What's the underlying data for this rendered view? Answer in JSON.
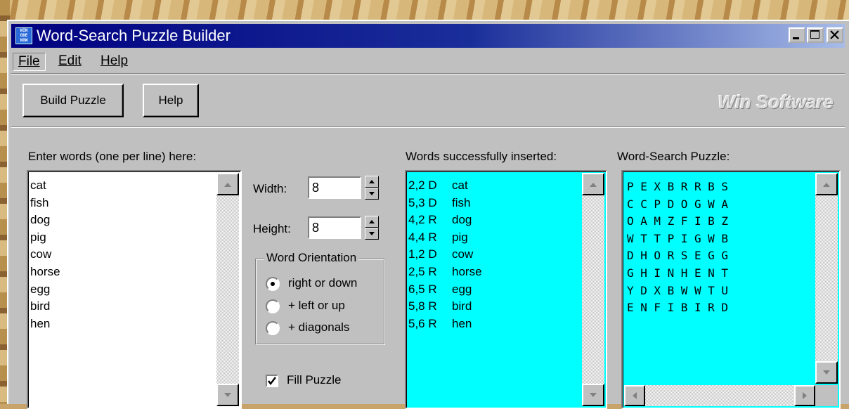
{
  "window": {
    "title": "Word-Search Puzzle Builder",
    "icon_text": "WIN ODE NOW",
    "title_buttons": [
      "minimize-icon",
      "maximize-icon",
      "close-icon"
    ]
  },
  "menu": {
    "items": [
      {
        "label": "File",
        "accel": "F"
      },
      {
        "label": "Edit",
        "accel": "E"
      },
      {
        "label": "Help",
        "accel": "H"
      }
    ]
  },
  "toolbar": {
    "build_label": "Build Puzzle",
    "help_label": "Help",
    "brand": "Win Software"
  },
  "words_panel": {
    "label": "Enter words (one per line) here:",
    "words": [
      "cat",
      "fish",
      "dog",
      "pig",
      "cow",
      "horse",
      "egg",
      "bird",
      "hen"
    ]
  },
  "settings": {
    "width_label": "Width:",
    "width_value": "8",
    "height_label": "Height:",
    "height_value": "8",
    "orientation_title": "Word Orientation",
    "orientation_options": [
      {
        "label": "right or down",
        "selected": true
      },
      {
        "label": "+ left or up",
        "selected": false
      },
      {
        "label": "+ diagonals",
        "selected": false
      }
    ],
    "fill_label": "Fill Puzzle",
    "fill_checked": true
  },
  "inserted_panel": {
    "label": "Words successfully inserted:",
    "entries": [
      {
        "pos": "2,2 D",
        "word": "cat"
      },
      {
        "pos": "5,3 D",
        "word": "fish"
      },
      {
        "pos": "4,2 R",
        "word": "dog"
      },
      {
        "pos": "4,4 R",
        "word": "pig"
      },
      {
        "pos": "1,2 D",
        "word": "cow"
      },
      {
        "pos": "2,5 R",
        "word": "horse"
      },
      {
        "pos": "6,5 R",
        "word": "egg"
      },
      {
        "pos": "5,8 R",
        "word": "bird"
      },
      {
        "pos": "5,6 R",
        "word": "hen"
      }
    ]
  },
  "puzzle_panel": {
    "label": "Word-Search Puzzle:",
    "rows": [
      [
        "P",
        "E",
        "X",
        "B",
        "R",
        "R",
        "B",
        "S"
      ],
      [
        "C",
        "C",
        "P",
        "D",
        "O",
        "G",
        "W",
        "A"
      ],
      [
        "O",
        "A",
        "M",
        "Z",
        "F",
        "I",
        "B",
        "Z"
      ],
      [
        "W",
        "T",
        "T",
        "P",
        "I",
        "G",
        "W",
        "B"
      ],
      [
        "D",
        "H",
        "O",
        "R",
        "S",
        "E",
        "G",
        "G"
      ],
      [
        "G",
        "H",
        "I",
        "N",
        "H",
        "E",
        "N",
        "T"
      ],
      [
        "Y",
        "D",
        "X",
        "B",
        "W",
        "W",
        "T",
        "U"
      ],
      [
        "E",
        "N",
        "F",
        "I",
        "B",
        "I",
        "R",
        "D"
      ]
    ]
  },
  "colors": {
    "list_bg": "#00ffff",
    "face": "#c0c0c0",
    "title_start": "#000080"
  }
}
